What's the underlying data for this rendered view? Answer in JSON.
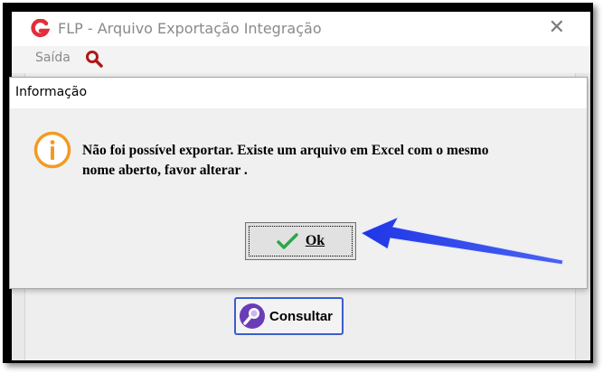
{
  "window": {
    "title": "FLP - Arquivo Exportação Integração",
    "close_glyph": "✕",
    "logo_letter": "G"
  },
  "menu": {
    "saida_label": "Saída",
    "search_icon": "search-icon"
  },
  "main": {
    "consultar_label": "Consultar"
  },
  "dialog": {
    "title": "Informação",
    "message_line1": "Não foi possível exportar. Existe um arquivo em Excel com o mesmo",
    "message_line2": "nome aberto, favor alterar .",
    "ok_label": "Ok"
  },
  "colors": {
    "logo_red": "#e0303b",
    "info_orange": "#f39a24",
    "check_green": "#2aa84a",
    "arrow_blue": "#1f36e6",
    "consultar_purple": "#6a3cb8"
  }
}
